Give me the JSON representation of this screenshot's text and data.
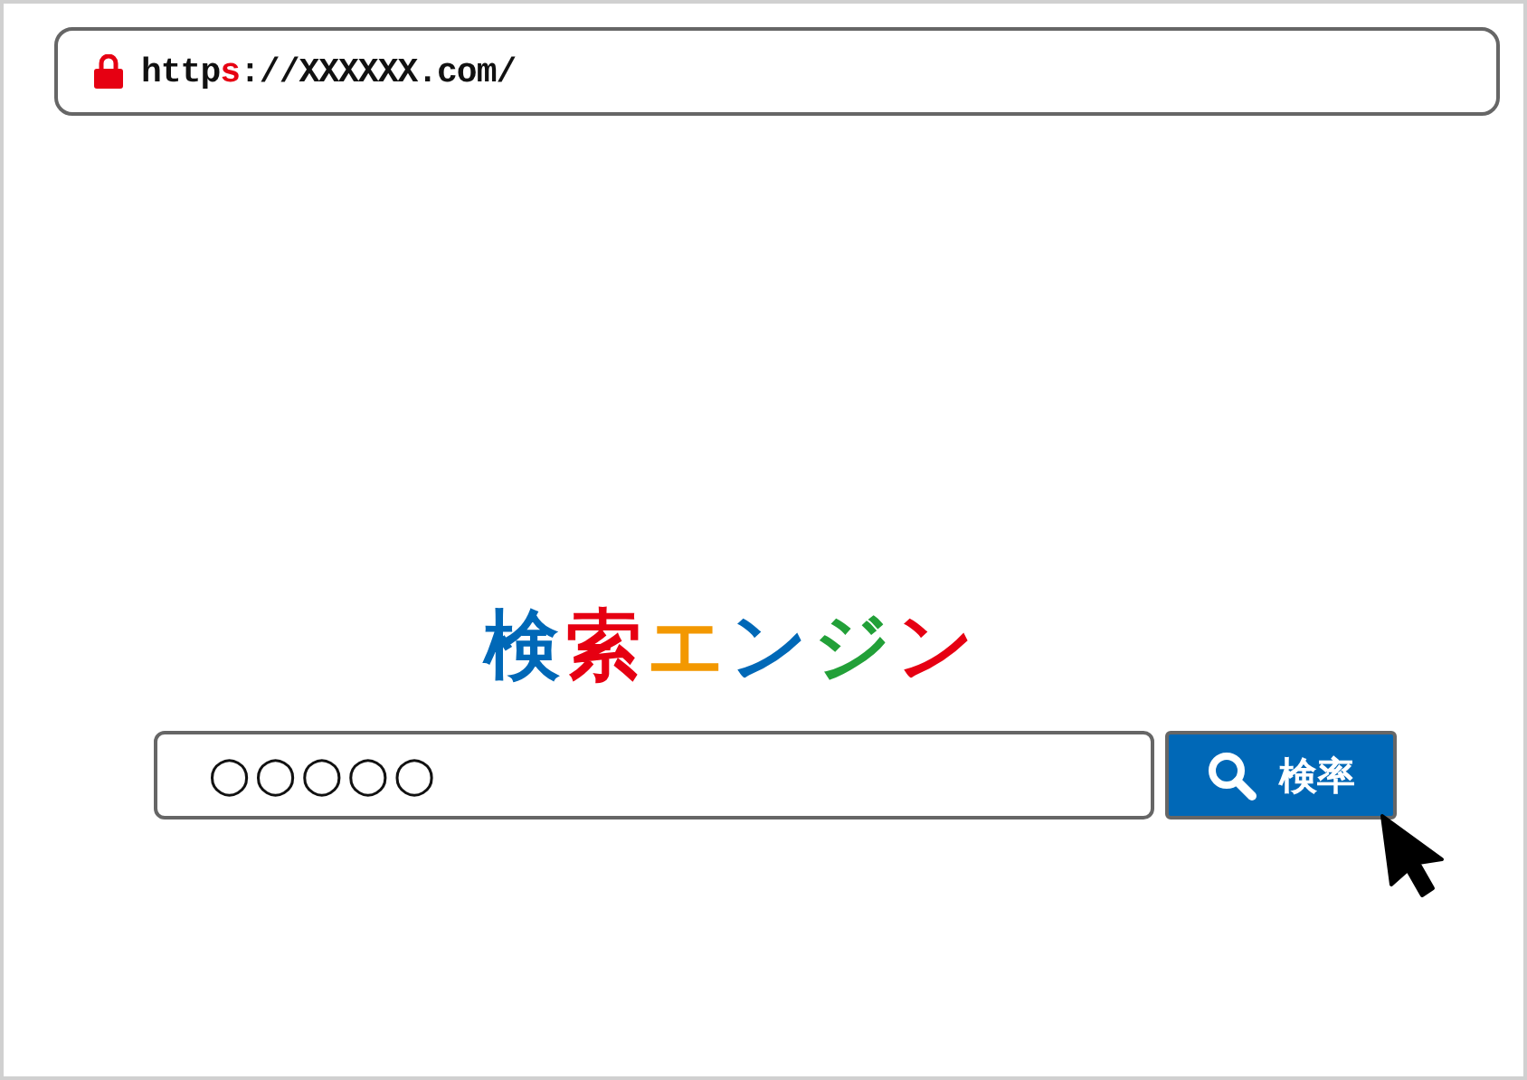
{
  "address_bar": {
    "secure": true,
    "url_parts": [
      {
        "text": "http",
        "color": "#111111"
      },
      {
        "text": "s",
        "color": "#e60012"
      },
      {
        "text": "://XXXXXX.com/",
        "color": "#111111"
      }
    ]
  },
  "logo": [
    {
      "text": "検",
      "color": "#0068b7"
    },
    {
      "text": "索",
      "color": "#e60012"
    },
    {
      "text": "エ",
      "color": "#f39800"
    },
    {
      "text": "ン",
      "color": "#0068b7"
    },
    {
      "text": "ジ",
      "color": "#22a038"
    },
    {
      "text": "ン",
      "color": "#e60012"
    }
  ],
  "search": {
    "value": "○○○○○",
    "button": "検率"
  }
}
